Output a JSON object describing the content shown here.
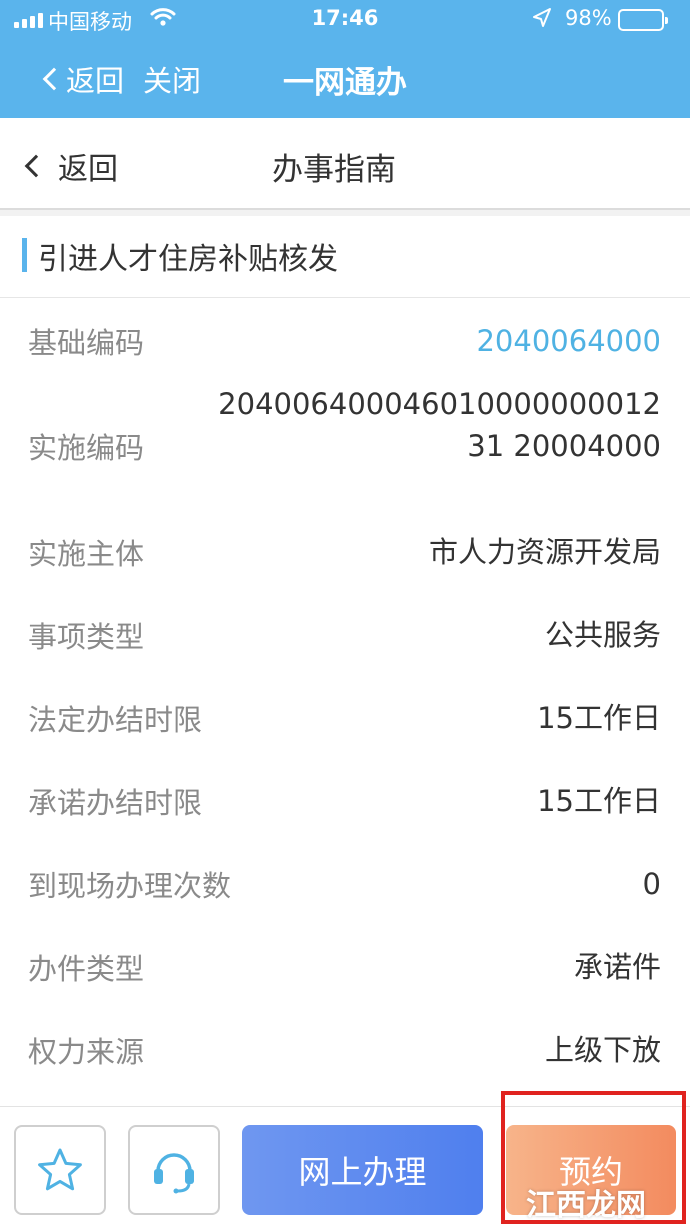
{
  "status_bar": {
    "carrier": "中国移动",
    "time": "17:46",
    "battery_percent": "98%"
  },
  "app_bar": {
    "back_label": "返回",
    "close_label": "关闭",
    "title": "一网通办"
  },
  "nav_bar": {
    "back_label": "返回",
    "title": "办事指南"
  },
  "section": {
    "title": "引进人才住房补贴核发"
  },
  "details": [
    {
      "label": "基础编码",
      "value": "2040064000"
    },
    {
      "label": "实施编码",
      "value": "20400640004601000000001231 20004000"
    },
    {
      "label": "实施主体",
      "value": "市人力资源开发局"
    },
    {
      "label": "事项类型",
      "value": "公共服务"
    },
    {
      "label": "法定办结时限",
      "value": "15工作日"
    },
    {
      "label": "承诺办结时限",
      "value": "15工作日"
    },
    {
      "label": "到现场办理次数",
      "value": "0"
    },
    {
      "label": "办件类型",
      "value": "承诺件"
    },
    {
      "label": "权力来源",
      "value": "上级下放"
    }
  ],
  "bottom_bar": {
    "favorite_icon": "star-icon",
    "service_icon": "headset-icon",
    "online_button": "网上办理",
    "reserve_button": "预约"
  },
  "watermark": "江西龙网",
  "colors": {
    "header_blue": "#5ab4ec",
    "link_blue": "#4fb2e3",
    "online_button": "#5b88ef",
    "reserve_button": "#f49a6c",
    "highlight_red": "#e0231f"
  }
}
